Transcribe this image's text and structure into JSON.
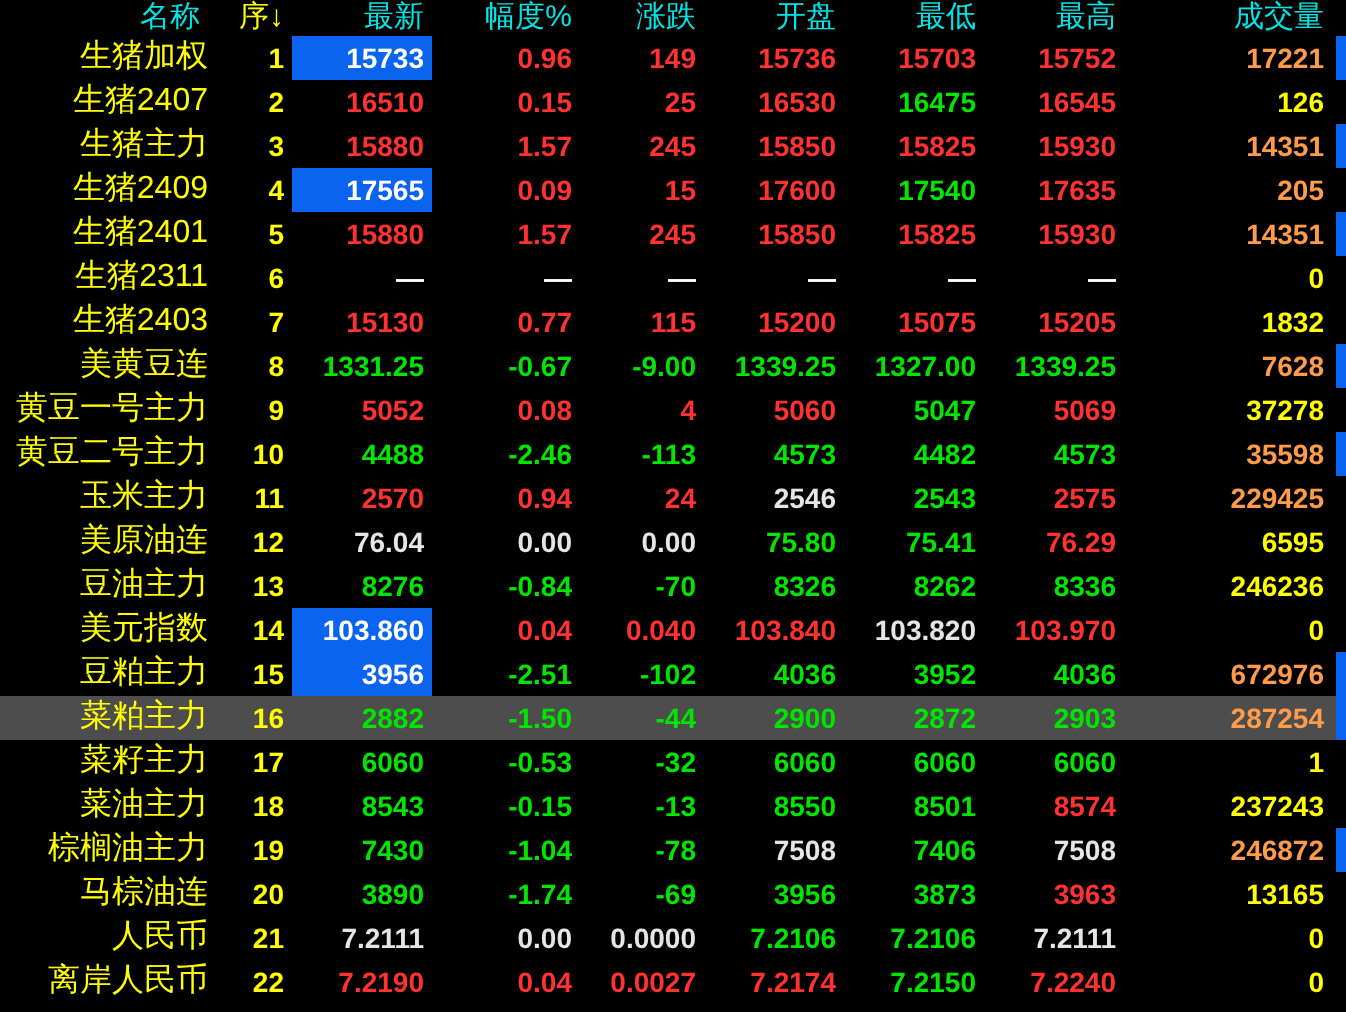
{
  "columns": [
    {
      "label": "名称",
      "color": "#00e6e6"
    },
    {
      "label": "序↓",
      "color": "#ffff00"
    },
    {
      "label": "最新",
      "color": "#00e6e6"
    },
    {
      "label": "幅度%",
      "color": "#00e6e6"
    },
    {
      "label": "涨跌",
      "color": "#00e6e6"
    },
    {
      "label": "开盘",
      "color": "#00e6e6"
    },
    {
      "label": "最低",
      "color": "#00e6e6"
    },
    {
      "label": "最高",
      "color": "#00e6e6"
    },
    {
      "label": "成交量",
      "color": "#00e6e6"
    }
  ],
  "rows": [
    {
      "name": "生猪加权",
      "no": "1",
      "flash": true,
      "marked": true,
      "selected": false,
      "cells": [
        {
          "text": "15733",
          "color": "#ffffff"
        },
        {
          "text": "0.96",
          "color": "#ff3232"
        },
        {
          "text": "149",
          "color": "#ff3232"
        },
        {
          "text": "15736",
          "color": "#ff3232"
        },
        {
          "text": "15703",
          "color": "#ff3232"
        },
        {
          "text": "15752",
          "color": "#ff3232"
        },
        {
          "text": "17221",
          "color": "#ff9c4a"
        }
      ]
    },
    {
      "name": "生猪2407",
      "no": "2",
      "flash": false,
      "marked": false,
      "selected": false,
      "cells": [
        {
          "text": "16510",
          "color": "#ff3232"
        },
        {
          "text": "0.15",
          "color": "#ff3232"
        },
        {
          "text": "25",
          "color": "#ff3232"
        },
        {
          "text": "16530",
          "color": "#ff3232"
        },
        {
          "text": "16475",
          "color": "#00e600"
        },
        {
          "text": "16545",
          "color": "#ff3232"
        },
        {
          "text": "126",
          "color": "#ffff00"
        }
      ]
    },
    {
      "name": "生猪主力",
      "no": "3",
      "flash": false,
      "marked": true,
      "selected": false,
      "cells": [
        {
          "text": "15880",
          "color": "#ff3232"
        },
        {
          "text": "1.57",
          "color": "#ff3232"
        },
        {
          "text": "245",
          "color": "#ff3232"
        },
        {
          "text": "15850",
          "color": "#ff3232"
        },
        {
          "text": "15825",
          "color": "#ff3232"
        },
        {
          "text": "15930",
          "color": "#ff3232"
        },
        {
          "text": "14351",
          "color": "#ff9c4a"
        }
      ]
    },
    {
      "name": "生猪2409",
      "no": "4",
      "flash": true,
      "marked": false,
      "selected": false,
      "cells": [
        {
          "text": "17565",
          "color": "#ffffff"
        },
        {
          "text": "0.09",
          "color": "#ff3232"
        },
        {
          "text": "15",
          "color": "#ff3232"
        },
        {
          "text": "17600",
          "color": "#ff3232"
        },
        {
          "text": "17540",
          "color": "#00e600"
        },
        {
          "text": "17635",
          "color": "#ff3232"
        },
        {
          "text": "205",
          "color": "#ff9c4a"
        }
      ]
    },
    {
      "name": "生猪2401",
      "no": "5",
      "flash": false,
      "marked": true,
      "selected": false,
      "cells": [
        {
          "text": "15880",
          "color": "#ff3232"
        },
        {
          "text": "1.57",
          "color": "#ff3232"
        },
        {
          "text": "245",
          "color": "#ff3232"
        },
        {
          "text": "15850",
          "color": "#ff3232"
        },
        {
          "text": "15825",
          "color": "#ff3232"
        },
        {
          "text": "15930",
          "color": "#ff3232"
        },
        {
          "text": "14351",
          "color": "#ff9c4a"
        }
      ]
    },
    {
      "name": "生猪2311",
      "no": "6",
      "flash": false,
      "marked": false,
      "selected": false,
      "cells": [
        {
          "text": "—",
          "color": "#ffffff"
        },
        {
          "text": "—",
          "color": "#ffffff"
        },
        {
          "text": "—",
          "color": "#ffffff"
        },
        {
          "text": "—",
          "color": "#ffffff"
        },
        {
          "text": "—",
          "color": "#ffffff"
        },
        {
          "text": "—",
          "color": "#ffffff"
        },
        {
          "text": "0",
          "color": "#ffff00"
        }
      ]
    },
    {
      "name": "生猪2403",
      "no": "7",
      "flash": false,
      "marked": false,
      "selected": false,
      "cells": [
        {
          "text": "15130",
          "color": "#ff3232"
        },
        {
          "text": "0.77",
          "color": "#ff3232"
        },
        {
          "text": "115",
          "color": "#ff3232"
        },
        {
          "text": "15200",
          "color": "#ff3232"
        },
        {
          "text": "15075",
          "color": "#ff3232"
        },
        {
          "text": "15205",
          "color": "#ff3232"
        },
        {
          "text": "1832",
          "color": "#ffff00"
        }
      ]
    },
    {
      "name": "美黄豆连",
      "no": "8",
      "flash": false,
      "marked": true,
      "selected": false,
      "cells": [
        {
          "text": "1331.25",
          "color": "#00e600"
        },
        {
          "text": "-0.67",
          "color": "#00e600"
        },
        {
          "text": "-9.00",
          "color": "#00e600"
        },
        {
          "text": "1339.25",
          "color": "#00e600"
        },
        {
          "text": "1327.00",
          "color": "#00e600"
        },
        {
          "text": "1339.25",
          "color": "#00e600"
        },
        {
          "text": "7628",
          "color": "#ff9c4a"
        }
      ]
    },
    {
      "name": "黄豆一号主力",
      "no": "9",
      "flash": false,
      "marked": false,
      "selected": false,
      "cells": [
        {
          "text": "5052",
          "color": "#ff3232"
        },
        {
          "text": "0.08",
          "color": "#ff3232"
        },
        {
          "text": "4",
          "color": "#ff3232"
        },
        {
          "text": "5060",
          "color": "#ff3232"
        },
        {
          "text": "5047",
          "color": "#00e600"
        },
        {
          "text": "5069",
          "color": "#ff3232"
        },
        {
          "text": "37278",
          "color": "#ffff00"
        }
      ]
    },
    {
      "name": "黄豆二号主力",
      "no": "10",
      "flash": false,
      "marked": true,
      "selected": false,
      "cells": [
        {
          "text": "4488",
          "color": "#00e600"
        },
        {
          "text": "-2.46",
          "color": "#00e600"
        },
        {
          "text": "-113",
          "color": "#00e600"
        },
        {
          "text": "4573",
          "color": "#00e600"
        },
        {
          "text": "4482",
          "color": "#00e600"
        },
        {
          "text": "4573",
          "color": "#00e600"
        },
        {
          "text": "35598",
          "color": "#ff9c4a"
        }
      ]
    },
    {
      "name": "玉米主力",
      "no": "11",
      "flash": false,
      "marked": false,
      "selected": false,
      "cells": [
        {
          "text": "2570",
          "color": "#ff3232"
        },
        {
          "text": "0.94",
          "color": "#ff3232"
        },
        {
          "text": "24",
          "color": "#ff3232"
        },
        {
          "text": "2546",
          "color": "#e6e6e6"
        },
        {
          "text": "2543",
          "color": "#00e600"
        },
        {
          "text": "2575",
          "color": "#ff3232"
        },
        {
          "text": "229425",
          "color": "#ff9c4a"
        }
      ]
    },
    {
      "name": "美原油连",
      "no": "12",
      "flash": false,
      "marked": false,
      "selected": false,
      "cells": [
        {
          "text": "76.04",
          "color": "#e6e6e6"
        },
        {
          "text": "0.00",
          "color": "#e6e6e6"
        },
        {
          "text": "0.00",
          "color": "#e6e6e6"
        },
        {
          "text": "75.80",
          "color": "#00e600"
        },
        {
          "text": "75.41",
          "color": "#00e600"
        },
        {
          "text": "76.29",
          "color": "#ff3232"
        },
        {
          "text": "6595",
          "color": "#ffff00"
        }
      ]
    },
    {
      "name": "豆油主力",
      "no": "13",
      "flash": false,
      "marked": false,
      "selected": false,
      "cells": [
        {
          "text": "8276",
          "color": "#00e600"
        },
        {
          "text": "-0.84",
          "color": "#00e600"
        },
        {
          "text": "-70",
          "color": "#00e600"
        },
        {
          "text": "8326",
          "color": "#00e600"
        },
        {
          "text": "8262",
          "color": "#00e600"
        },
        {
          "text": "8336",
          "color": "#00e600"
        },
        {
          "text": "246236",
          "color": "#ffff00"
        }
      ]
    },
    {
      "name": "美元指数",
      "no": "14",
      "flash": true,
      "marked": false,
      "selected": false,
      "cells": [
        {
          "text": "103.860",
          "color": "#ffffff"
        },
        {
          "text": "0.04",
          "color": "#ff3232"
        },
        {
          "text": "0.040",
          "color": "#ff3232"
        },
        {
          "text": "103.840",
          "color": "#ff3232"
        },
        {
          "text": "103.820",
          "color": "#e6e6e6"
        },
        {
          "text": "103.970",
          "color": "#ff3232"
        },
        {
          "text": "0",
          "color": "#ffff00"
        }
      ]
    },
    {
      "name": "豆粕主力",
      "no": "15",
      "flash": true,
      "marked": true,
      "selected": false,
      "cells": [
        {
          "text": "3956",
          "color": "#ffffff"
        },
        {
          "text": "-2.51",
          "color": "#00e600"
        },
        {
          "text": "-102",
          "color": "#00e600"
        },
        {
          "text": "4036",
          "color": "#00e600"
        },
        {
          "text": "3952",
          "color": "#00e600"
        },
        {
          "text": "4036",
          "color": "#00e600"
        },
        {
          "text": "672976",
          "color": "#ff9c4a"
        }
      ]
    },
    {
      "name": "菜粕主力",
      "no": "16",
      "flash": false,
      "marked": true,
      "selected": true,
      "cells": [
        {
          "text": "2882",
          "color": "#00e600"
        },
        {
          "text": "-1.50",
          "color": "#00e600"
        },
        {
          "text": "-44",
          "color": "#00e600"
        },
        {
          "text": "2900",
          "color": "#00e600"
        },
        {
          "text": "2872",
          "color": "#00e600"
        },
        {
          "text": "2903",
          "color": "#00e600"
        },
        {
          "text": "287254",
          "color": "#ff9c4a"
        }
      ]
    },
    {
      "name": "菜籽主力",
      "no": "17",
      "flash": false,
      "marked": false,
      "selected": false,
      "cells": [
        {
          "text": "6060",
          "color": "#00e600"
        },
        {
          "text": "-0.53",
          "color": "#00e600"
        },
        {
          "text": "-32",
          "color": "#00e600"
        },
        {
          "text": "6060",
          "color": "#00e600"
        },
        {
          "text": "6060",
          "color": "#00e600"
        },
        {
          "text": "6060",
          "color": "#00e600"
        },
        {
          "text": "1",
          "color": "#ffff00"
        }
      ]
    },
    {
      "name": "菜油主力",
      "no": "18",
      "flash": false,
      "marked": false,
      "selected": false,
      "cells": [
        {
          "text": "8543",
          "color": "#00e600"
        },
        {
          "text": "-0.15",
          "color": "#00e600"
        },
        {
          "text": "-13",
          "color": "#00e600"
        },
        {
          "text": "8550",
          "color": "#00e600"
        },
        {
          "text": "8501",
          "color": "#00e600"
        },
        {
          "text": "8574",
          "color": "#ff3232"
        },
        {
          "text": "237243",
          "color": "#ffff00"
        }
      ]
    },
    {
      "name": "棕榈油主力",
      "no": "19",
      "flash": false,
      "marked": true,
      "selected": false,
      "cells": [
        {
          "text": "7430",
          "color": "#00e600"
        },
        {
          "text": "-1.04",
          "color": "#00e600"
        },
        {
          "text": "-78",
          "color": "#00e600"
        },
        {
          "text": "7508",
          "color": "#e6e6e6"
        },
        {
          "text": "7406",
          "color": "#00e600"
        },
        {
          "text": "7508",
          "color": "#e6e6e6"
        },
        {
          "text": "246872",
          "color": "#ff9c4a"
        }
      ]
    },
    {
      "name": "马棕油连",
      "no": "20",
      "flash": false,
      "marked": false,
      "selected": false,
      "cells": [
        {
          "text": "3890",
          "color": "#00e600"
        },
        {
          "text": "-1.74",
          "color": "#00e600"
        },
        {
          "text": "-69",
          "color": "#00e600"
        },
        {
          "text": "3956",
          "color": "#00e600"
        },
        {
          "text": "3873",
          "color": "#00e600"
        },
        {
          "text": "3963",
          "color": "#ff3232"
        },
        {
          "text": "13165",
          "color": "#ffff00"
        }
      ]
    },
    {
      "name": "人民币",
      "no": "21",
      "flash": false,
      "marked": false,
      "selected": false,
      "cells": [
        {
          "text": "7.2111",
          "color": "#e6e6e6"
        },
        {
          "text": "0.00",
          "color": "#e6e6e6"
        },
        {
          "text": "0.0000",
          "color": "#e6e6e6"
        },
        {
          "text": "7.2106",
          "color": "#00e600"
        },
        {
          "text": "7.2106",
          "color": "#00e600"
        },
        {
          "text": "7.2111",
          "color": "#e6e6e6"
        },
        {
          "text": "0",
          "color": "#ffff00"
        }
      ]
    },
    {
      "name": "离岸人民币",
      "no": "22",
      "flash": false,
      "marked": false,
      "selected": false,
      "cells": [
        {
          "text": "7.2190",
          "color": "#ff3232"
        },
        {
          "text": "0.04",
          "color": "#ff3232"
        },
        {
          "text": "0.0027",
          "color": "#ff3232"
        },
        {
          "text": "7.2174",
          "color": "#ff3232"
        },
        {
          "text": "7.2150",
          "color": "#00e600"
        },
        {
          "text": "7.2240",
          "color": "#ff3232"
        },
        {
          "text": "0",
          "color": "#ffff00"
        }
      ]
    }
  ]
}
